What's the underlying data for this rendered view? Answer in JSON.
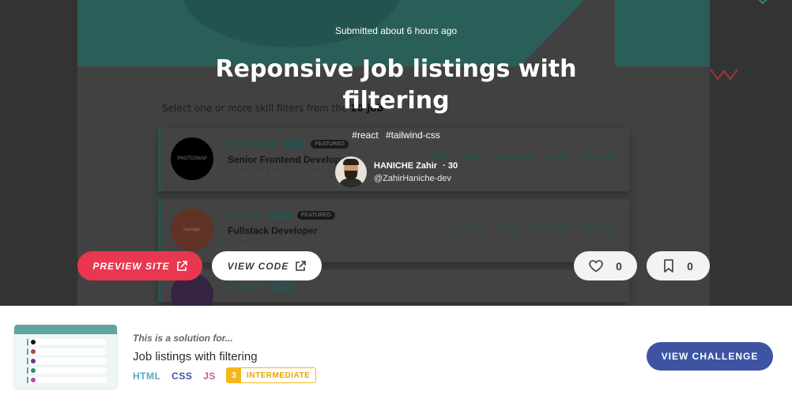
{
  "hero": {
    "submitted": "Submitted about 6 hours ago",
    "title": "Reponsive Job listings with filtering",
    "tags": [
      "#react",
      "#tailwind-css"
    ],
    "author": {
      "name": "HANICHE Zahir",
      "reputation": "30",
      "handle": "@ZahirHaniche-dev"
    },
    "preview_site_label": "PREVIEW SITE",
    "view_code_label": "VIEW CODE",
    "likes": "0",
    "bookmarks": "0",
    "accent_color": "#e8374f"
  },
  "preview": {
    "subtitle_text": "Select one or more skill filters from the",
    "subtitle_bold": "10 job",
    "jobs": [
      {
        "logo": "PHOTOSNAP",
        "company": "Photosnap",
        "new": "NEW!",
        "featured": "FEATURED",
        "title": "Senior Frontend Developer",
        "meta": "1d ago · Full Time · USA Only",
        "tags": [
          "HTML",
          "CSS",
          "JavaScript",
          "Senior",
          "Frontend"
        ]
      },
      {
        "logo": "manage",
        "company": "Manage",
        "new": "NEW!",
        "featured": "FEATURED",
        "title": "Fullstack Developer",
        "meta": "1d ago · Part Time · Remote",
        "tags": [
          "Python",
          "React",
          "Midweight",
          "Fullstack"
        ]
      },
      {
        "logo": "",
        "company": "Account",
        "new": "NEW!",
        "featured": "",
        "title": "",
        "meta": "",
        "tags": []
      }
    ]
  },
  "challenge": {
    "solution_for": "This is a solution for...",
    "name": "Job listings with filtering",
    "languages": [
      "HTML",
      "CSS",
      "JS"
    ],
    "level_number": "3",
    "level_label": "INTERMEDIATE",
    "view_challenge_label": "VIEW CHALLENGE",
    "button_color": "#3e54a3"
  }
}
